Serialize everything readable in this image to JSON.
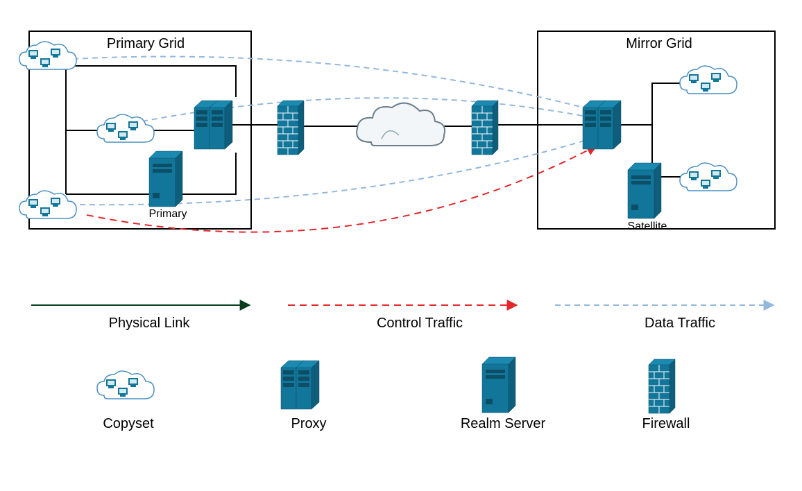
{
  "diagram": {
    "primaryGridTitle": "Primary Grid",
    "mirrorGridTitle": "Mirror Grid",
    "primaryLabel": "Primary",
    "satelliteLabel": "Satellite",
    "legend": {
      "physicalLink": "Physical Link",
      "controlTraffic": "Control Traffic",
      "dataTraffic": "Data Traffic",
      "copyset": "Copyset",
      "proxy": "Proxy",
      "realmServer": "Realm Server",
      "firewall": "Firewall"
    },
    "colors": {
      "teal": "#12769a",
      "tealLight": "#8fc5d9",
      "dashBlue": "#4a90c2",
      "dashBlueLight": "#92b8dc",
      "dashRed": "#e3272a",
      "physical": "#0a3d1e",
      "border": "#000000",
      "cloudFill": "#e6ecf0",
      "cloudStroke": "#6a7d8c"
    }
  }
}
